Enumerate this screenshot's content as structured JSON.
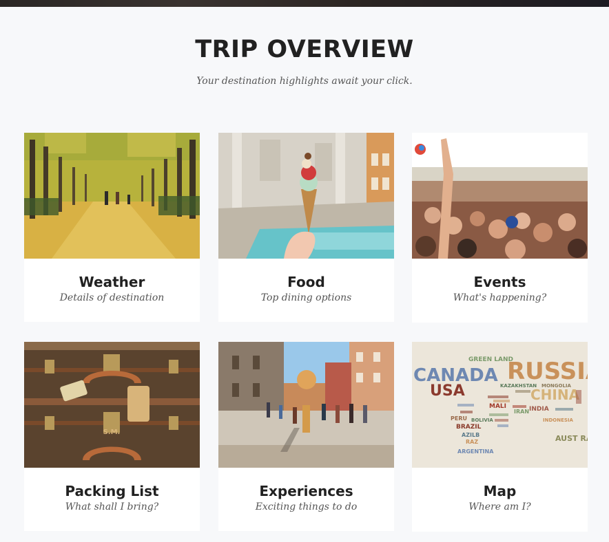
{
  "header": {
    "title": "TRIP OVERVIEW",
    "subtitle": "Your destination highlights await your click."
  },
  "cards": [
    {
      "title": "Weather",
      "subtitle": "Details of destination",
      "image": "autumn-ginkgo-avenue-image"
    },
    {
      "title": "Food",
      "subtitle": "Top dining options",
      "image": "gelato-at-fountain-image"
    },
    {
      "title": "Events",
      "subtitle": "What's happening?",
      "image": "concert-crowd-image"
    },
    {
      "title": "Packing List",
      "subtitle": "What shall I bring?",
      "image": "vintage-luggage-image"
    },
    {
      "title": "Experiences",
      "subtitle": "Exciting things to do",
      "image": "busy-european-street-image"
    },
    {
      "title": "Map",
      "subtitle": "Where am I?",
      "image": "word-cloud-world-map-image"
    }
  ],
  "map_words": [
    "CANADA",
    "USA",
    "RUSSIA",
    "CHINA",
    "GREEN LAND",
    "KAZAKHSTAN",
    "MONGOLIA",
    "INDIA",
    "MALI",
    "BRAZIL",
    "AZILB",
    "RAZ",
    "ARGENTINA",
    "AUST RALIA",
    "INDONESIA",
    "IRAN",
    "PERU",
    "BOLIVIA"
  ],
  "luggage_monogram": "S.M.",
  "colors": {
    "background": "#f7f8fa",
    "card": "#ffffff",
    "title_text": "#212121",
    "subtitle_text": "#555555"
  }
}
